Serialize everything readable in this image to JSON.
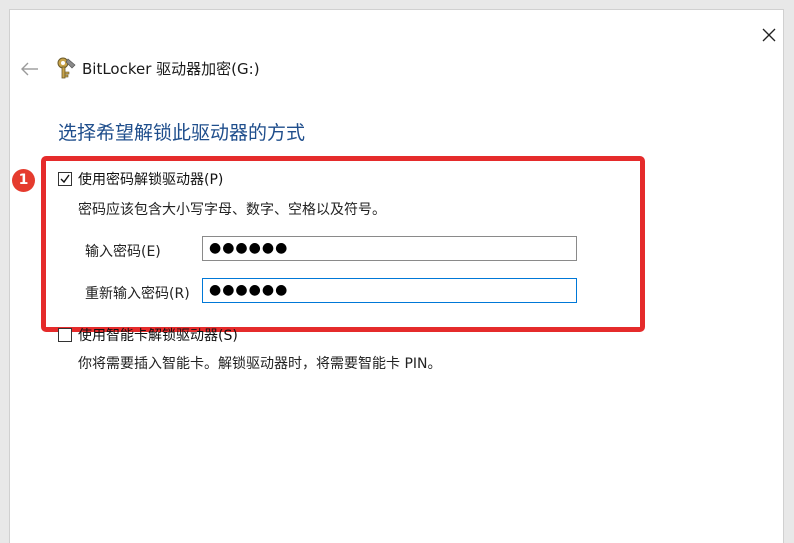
{
  "window": {
    "title": "BitLocker 驱动器加密(G:)",
    "icons": {
      "back": "back-arrow-icon",
      "close": "close-icon",
      "app": "bitlocker-key-icon"
    }
  },
  "page": {
    "heading": "选择希望解锁此驱动器的方式"
  },
  "annotation": {
    "step_number": "1",
    "highlight_color": "#e52b2b",
    "badge_color": "#e53b2e"
  },
  "password_option": {
    "checked": true,
    "label": "使用密码解锁驱动器(P)",
    "hint": "密码应该包含大小写字母、数字、空格以及符号。",
    "enter_label": "输入密码(E)",
    "enter_value": "●●●●●●",
    "reenter_label": "重新输入密码(R)",
    "reenter_value": "●●●●●●"
  },
  "smartcard_option": {
    "checked": false,
    "label": "使用智能卡解锁驱动器(S)",
    "hint": "你将需要插入智能卡。解锁驱动器时，将需要智能卡 PIN。"
  },
  "colors": {
    "heading": "#1f4e8c",
    "focus_border": "#0078d7"
  }
}
